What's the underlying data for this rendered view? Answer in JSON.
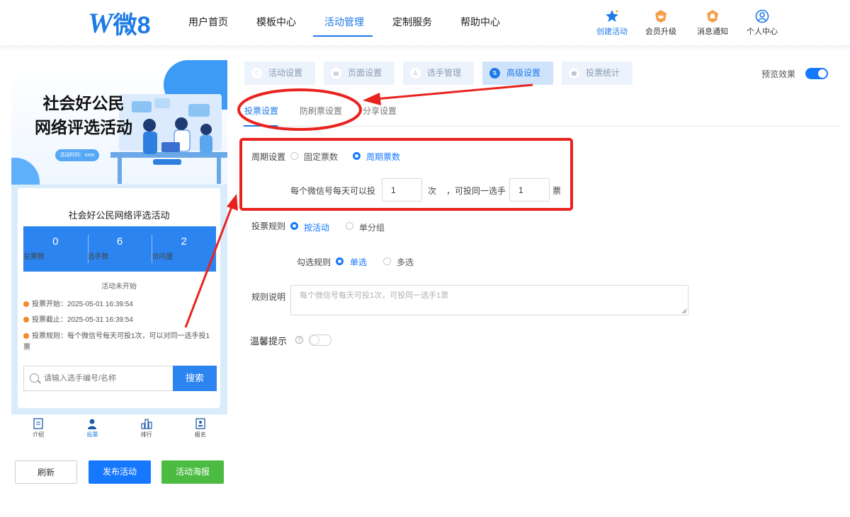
{
  "brand": {
    "logo_w": "W",
    "logo_rest": "微8"
  },
  "nav": {
    "items": [
      {
        "label": "用户首页"
      },
      {
        "label": "模板中心"
      },
      {
        "label": "活动管理"
      },
      {
        "label": "定制服务"
      },
      {
        "label": "帮助中心"
      }
    ],
    "active_index": 2,
    "right_links": [
      {
        "label": "创建活动",
        "icon": "star-icon",
        "color": "#1e7ae6"
      },
      {
        "label": "会员升级",
        "icon": "crown-icon",
        "color": "#f08a2a"
      },
      {
        "label": "消息通知",
        "icon": "bell-icon",
        "color": "#f08a2a"
      },
      {
        "label": "个人中心",
        "icon": "user-icon",
        "color": "#1e7ae6"
      }
    ]
  },
  "preview": {
    "banner_title_line1": "社会好公民",
    "banner_title_line2": "网络评选活动",
    "banner_chip": "活动时间：xxxx",
    "card_title": "社会好公民网络评选活动",
    "stats": [
      {
        "value": "0",
        "label": "总票数"
      },
      {
        "value": "6",
        "label": "选手数"
      },
      {
        "value": "2",
        "label": "访问量"
      }
    ],
    "status": "活动未开始",
    "info": [
      "投票开始：2025-05-01 16:39:54",
      "投票截止：2025-05-31 16:39:54",
      "投票规则：每个微信号每天可投1次，可以对同一选手投1票"
    ],
    "search_placeholder": "请输入选手编号/名称",
    "search_button": "搜索",
    "tabbar": [
      {
        "label": "介绍",
        "icon": "intro-icon"
      },
      {
        "label": "投票",
        "icon": "vote-person-icon"
      },
      {
        "label": "排行",
        "icon": "rank-icon"
      },
      {
        "label": "报名",
        "icon": "signup-icon"
      }
    ],
    "buttons": {
      "refresh": "刷新",
      "publish": "发布活动",
      "poster": "活动海报"
    }
  },
  "settings": {
    "steps": [
      {
        "label": "活动设置",
        "icon": "heart-icon"
      },
      {
        "label": "页面设置",
        "icon": "page-icon"
      },
      {
        "label": "选手管理",
        "icon": "person-icon"
      },
      {
        "label": "高级设置",
        "icon": "sliders-icon"
      },
      {
        "label": "投票统计",
        "icon": "chart-icon"
      }
    ],
    "active_step": 3,
    "preview_label": "预览效果",
    "preview_on": true,
    "subtabs": [
      {
        "label": "投票设置"
      },
      {
        "label": "防刷票设置"
      },
      {
        "label": "分享设置"
      }
    ],
    "active_subtab": 0,
    "cycle": {
      "label": "周期设置",
      "options": [
        "固定票数",
        "周期票数"
      ],
      "selected": 1,
      "line_prefix": "每个微信号每天可以投",
      "times_value": "1",
      "times_unit": "次",
      "mid_text": "，可投同一选手",
      "votes_value": "1",
      "votes_unit": "票"
    },
    "vote_rule": {
      "label": "投票规则",
      "options": [
        "按活动",
        "单分组"
      ],
      "selected": 0
    },
    "check_rule": {
      "label": "勾选规则",
      "options": [
        "单选",
        "多选"
      ],
      "selected": 0
    },
    "rule_desc": {
      "label": "规则说明",
      "placeholder": "每个微信号每天可投1次，可投同一选手1票"
    },
    "tips": {
      "label": "温馨提示",
      "on": false
    }
  }
}
